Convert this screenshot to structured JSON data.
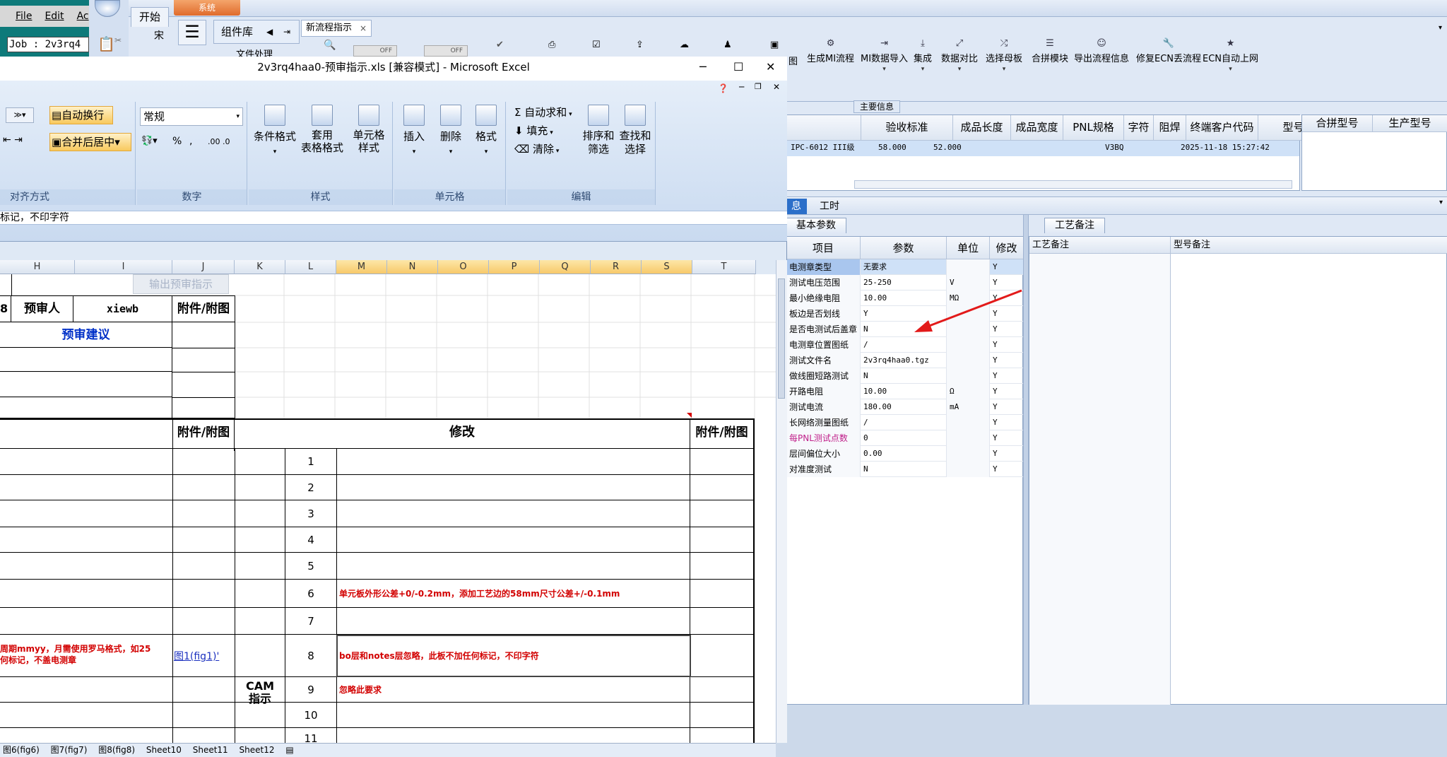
{
  "job_window": {
    "menu": [
      "File",
      "Edit",
      "Ac"
    ],
    "job_field": "Job : 2v3rq4"
  },
  "erp": {
    "tab_system": "系统",
    "tab_start": "开始",
    "comp_lib": "组件库",
    "left_partial": "文件处理",
    "font_partial": "宋",
    "doc_tab": "新流程指示",
    "toggles": [
      "OFF",
      "OFF"
    ],
    "ribbon": [
      {
        "label": "生成MI流程",
        "dd": false
      },
      {
        "label": "MI数据导入",
        "dd": true
      },
      {
        "label": "集成",
        "dd": true
      },
      {
        "label": "数据对比",
        "dd": true
      },
      {
        "label": "选择母板",
        "dd": true
      },
      {
        "label": "合拼模块",
        "dd": false
      },
      {
        "label": "导出流程信息",
        "dd": false
      },
      {
        "label": "修复ECN丢流程",
        "dd": false
      },
      {
        "label": "ECN自动上网",
        "dd": true
      }
    ],
    "ribbon_partial": "图",
    "main_info_label": "主要信息",
    "main_grid": {
      "headers": [
        "验收标准",
        "成品长度",
        "成品宽度",
        "PNL规格",
        "字符",
        "阻焊",
        "终端客户代码",
        "型号创建时间"
      ],
      "row": [
        "IPC-6012 III级",
        "58.000",
        "52.000",
        "",
        "",
        "",
        "V3BQ",
        "2025-11-18 15:27:42"
      ]
    },
    "side_grid": {
      "headers": [
        "合拼型号",
        "生产型号"
      ]
    },
    "lower_tabs": [
      "息",
      "工时"
    ],
    "params_tab": "基本参数",
    "params_headers": [
      "项目",
      "参数",
      "单位",
      "修改"
    ],
    "params_rows": [
      {
        "item": "电测章类型",
        "param": "无要求",
        "unit": "",
        "mod": "Y"
      },
      {
        "item": "测试电压范围",
        "param": "25-250",
        "unit": "V",
        "mod": "Y"
      },
      {
        "item": "最小绝缘电阻",
        "param": "10.00",
        "unit": "MΩ",
        "mod": "Y"
      },
      {
        "item": "板边是否划线",
        "param": "Y",
        "unit": "",
        "mod": "Y"
      },
      {
        "item": "是否电测试后盖章",
        "param": "N",
        "unit": "",
        "mod": "Y"
      },
      {
        "item": "电测章位置图纸",
        "param": "/",
        "unit": "",
        "mod": "Y"
      },
      {
        "item": "测试文件名",
        "param": "2v3rq4haa0.tgz",
        "unit": "",
        "mod": "Y"
      },
      {
        "item": "做线圈短路测试",
        "param": "N",
        "unit": "",
        "mod": "Y"
      },
      {
        "item": "开路电阻",
        "param": "10.00",
        "unit": "Ω",
        "mod": "Y"
      },
      {
        "item": "测试电流",
        "param": "180.00",
        "unit": "mA",
        "mod": "Y"
      },
      {
        "item": "长网络测量图纸",
        "param": "/",
        "unit": "",
        "mod": "Y"
      },
      {
        "item": "每PNL测试点数",
        "param": "0",
        "unit": "",
        "mod": "Y"
      },
      {
        "item": "层间偏位大小",
        "param": "0.00",
        "unit": "",
        "mod": "Y"
      },
      {
        "item": "对准度测试",
        "param": "N",
        "unit": "",
        "mod": "Y"
      }
    ],
    "notes_tab": "工艺备注",
    "notes_headers": [
      "工艺备注",
      "型号备注"
    ]
  },
  "excel": {
    "title": "2v3rq4haa0-预审指示.xls  [兼容模式] - Microsoft Excel",
    "win_controls": [
      "─",
      "☐",
      "✕"
    ],
    "ribbon": {
      "wrap_text": "自动换行",
      "merge_center": "合并后居中",
      "number_format": "常规",
      "pct": "%",
      "comma": ",",
      "inc_dec": ".00 .0",
      "cond_format": "条件格式",
      "table_format": "套用\n表格格式",
      "cell_style": "单元格\n样式",
      "insert": "插入",
      "delete": "删除",
      "format": "格式",
      "autosum": "自动求和",
      "fill": "填充",
      "clear": "清除",
      "sort": "排序和\n筛选",
      "find": "查找和\n选择",
      "groups": [
        "对齐方式",
        "数字",
        "样式",
        "单元格",
        "编辑"
      ]
    },
    "formula_text": "标记，不印字符",
    "columns": [
      "H",
      "I",
      "J",
      "K",
      "L",
      "M",
      "N",
      "O",
      "P",
      "Q",
      "R",
      "S",
      "T"
    ],
    "button_output": "输出预审指示",
    "reviewer_label": "预审人",
    "reviewer_name": "xiewb",
    "attach_label": "附件/附图",
    "row_num_8": "8",
    "suggest_label": "预审建议",
    "modify_label": "修改",
    "cam_label": "CAM\n指示",
    "rows": [
      "1",
      "2",
      "3",
      "4",
      "5",
      "6",
      "7",
      "8",
      "9",
      "10",
      "11"
    ],
    "row6_text": "单元板外形公差+0/-0.2mm，添加工艺边的58mm尺寸公差+/-0.1mm",
    "row8_text": "bo层和notes层忽略，此板不加任何标记，不印字符",
    "row9_text": "忽略此要求",
    "left8_text_1": "周期mmyy，月需使用罗马格式，如25",
    "left8_text_2": "何标记，不盖电测章",
    "fig_link": "图1(fig1)'",
    "sheet_tabs": [
      "图6(fig6)",
      "图7(fig7)",
      "图8(fig8)",
      "Sheet10",
      "Sheet11",
      "Sheet12"
    ]
  }
}
